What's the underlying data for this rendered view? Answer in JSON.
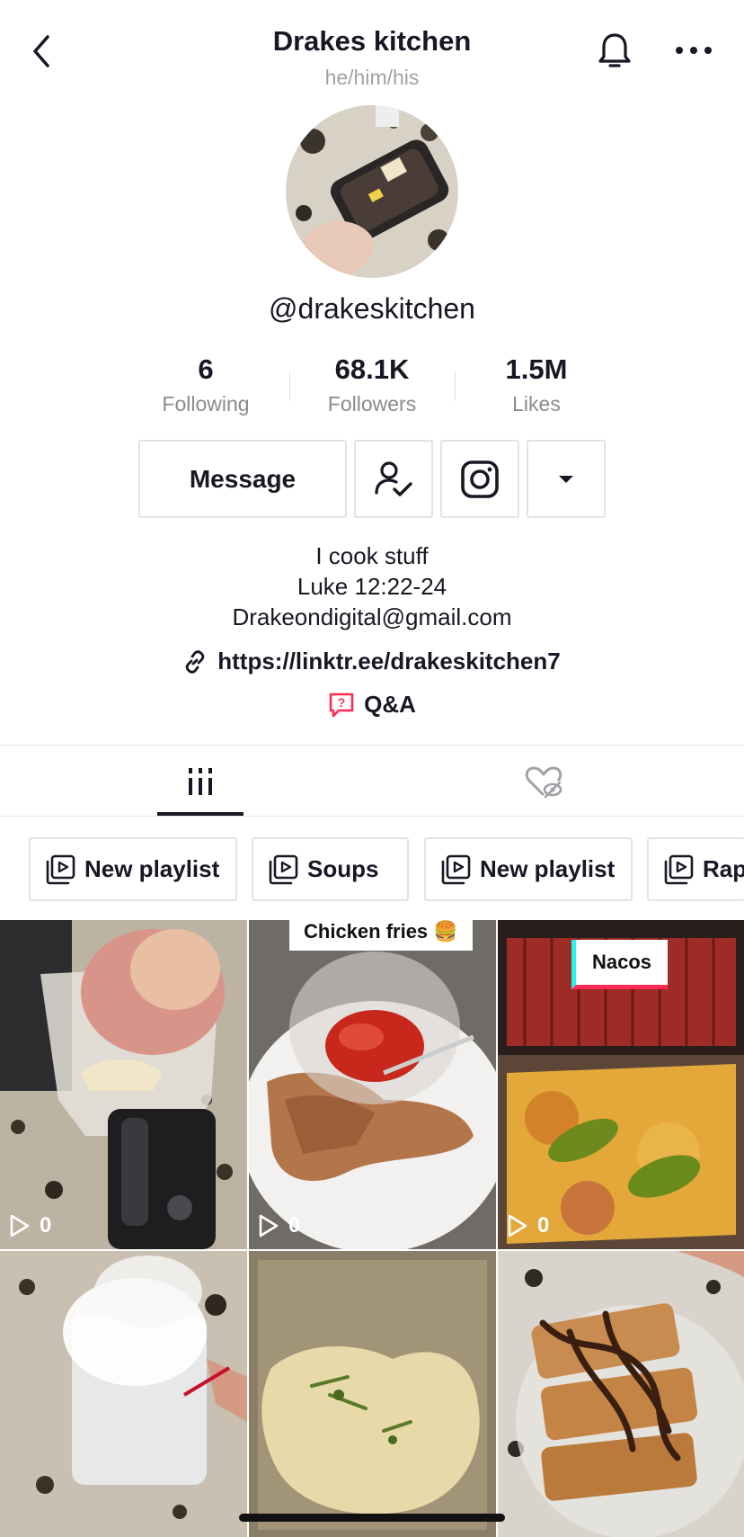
{
  "header": {
    "title": "Drakes kitchen",
    "pronouns": "he/him/his",
    "back_icon": "chevron-left-icon",
    "bell_icon": "bell-icon",
    "more_icon": "more-horizontal-icon"
  },
  "profile": {
    "username": "@drakeskitchen",
    "stats": [
      {
        "value": "6",
        "label": "Following"
      },
      {
        "value": "68.1K",
        "label": "Followers"
      },
      {
        "value": "1.5M",
        "label": "Likes"
      }
    ]
  },
  "actions": {
    "message_label": "Message",
    "follow_icon": "user-check-icon",
    "instagram_icon": "instagram-icon",
    "dropdown_icon": "caret-down-icon"
  },
  "bio": {
    "lines": [
      "I cook stuff",
      "Luke 12:22-24",
      "Drakeondigital@gmail.com"
    ],
    "link": "https://linktr.ee/drakeskitchen7",
    "qa_label": "Q&A"
  },
  "tabs": {
    "videos_icon": "grid-icon",
    "liked_icon": "liked-hidden-icon"
  },
  "playlists": [
    {
      "label": "New playlist"
    },
    {
      "label": "Soups"
    },
    {
      "label": "New playlist"
    },
    {
      "label": "Rap"
    }
  ],
  "videos": [
    {
      "views": "0",
      "label": ""
    },
    {
      "views": "0",
      "label": "Chicken fries 🍔"
    },
    {
      "views": "0",
      "label": "Nacos"
    },
    {
      "views": "",
      "label": ""
    },
    {
      "views": "",
      "label": ""
    },
    {
      "views": "",
      "label": ""
    }
  ],
  "colors": {
    "text": "#161823",
    "muted": "#8a8b91",
    "border": "#e3e3e4",
    "qa_accent": "#fe2c55"
  }
}
